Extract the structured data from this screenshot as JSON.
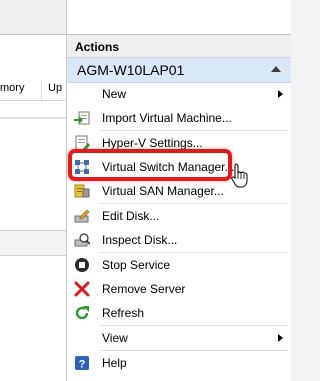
{
  "left_pane": {
    "columns": [
      {
        "label": "mory"
      },
      {
        "label": "Up"
      }
    ]
  },
  "actions": {
    "title": "Actions",
    "host": "AGM-W10LAP01",
    "items": [
      {
        "label": "New",
        "icon": "blank",
        "submenu": true
      },
      {
        "label": "Import Virtual Machine...",
        "icon": "import-vm-icon"
      },
      {
        "label": "Hyper-V Settings...",
        "icon": "settings-icon"
      },
      {
        "label": "Virtual Switch Manager...",
        "icon": "virtual-switch-icon"
      },
      {
        "label": "Virtual SAN Manager...",
        "icon": "virtual-san-icon"
      },
      {
        "label": "Edit Disk...",
        "icon": "edit-disk-icon"
      },
      {
        "label": "Inspect Disk...",
        "icon": "inspect-disk-icon"
      },
      {
        "label": "Stop Service",
        "icon": "stop-icon"
      },
      {
        "label": "Remove Server",
        "icon": "remove-x-icon"
      },
      {
        "label": "Refresh",
        "icon": "refresh-icon"
      },
      {
        "label": "View",
        "icon": "blank",
        "submenu": true
      },
      {
        "label": "Help",
        "icon": "help-icon"
      }
    ]
  },
  "colors": {
    "host_bar": "#d9e8f9",
    "highlight": "#e11b1b"
  }
}
